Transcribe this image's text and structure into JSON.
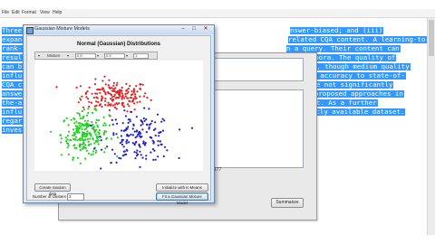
{
  "menubar": {
    "items": [
      "File",
      "Edit",
      "Format",
      "View",
      "Help"
    ]
  },
  "document_lines": [
    "Three",
    "expan",
    "rank-",
    "resul",
    "can b",
    "influ",
    "CQA c",
    "answe",
    "the-a",
    "influ",
    "regar",
    "inves"
  ],
  "document_right_lines": [
    "nswer-biased; and (iii)",
    "related CQA content. A learning-to-",
    "n a query. Their content can",
    "corpora. The quality of",
    "ies, though medium quality",
    "r) accuracy to state-of-",
    "are not significantly",
    "y proposed approaches in",
    "ent. As a further",
    "icly available dataset."
  ],
  "dialog": {
    "title": "Gaussian Mixture Models",
    "minimize": "–",
    "maximize": "□",
    "close": "✕",
    "plot_title": "Normal (Gaussian) Distributions",
    "toolbar": {
      "mixture_label": "Mixture",
      "field1": "0.5",
      "field2": "0.5",
      "field3": "1"
    },
    "buttons": {
      "create_random": "Create random data",
      "kmeans": "Initialize with K-Means",
      "fit_gmm": "Fit a Gaussian Mixture Model"
    },
    "clusters_label": "Number of clusters",
    "clusters_value": "3"
  },
  "background_window": {
    "count_text": "177",
    "button_label": "Summarize"
  },
  "chart_data": {
    "type": "scatter",
    "title": "Normal (Gaussian) Distributions",
    "xlabel": "",
    "ylabel": "",
    "grid": false,
    "series": [
      {
        "color": "#e02020",
        "center": [
          0.48,
          0.68
        ],
        "spread": [
          0.1,
          0.07
        ],
        "count": 180
      },
      {
        "color": "#20d020",
        "center": [
          0.3,
          0.33
        ],
        "spread": [
          0.07,
          0.1
        ],
        "count": 220
      },
      {
        "color": "#2020c8",
        "center": [
          0.62,
          0.3
        ],
        "spread": [
          0.1,
          0.11
        ],
        "count": 160
      }
    ]
  }
}
